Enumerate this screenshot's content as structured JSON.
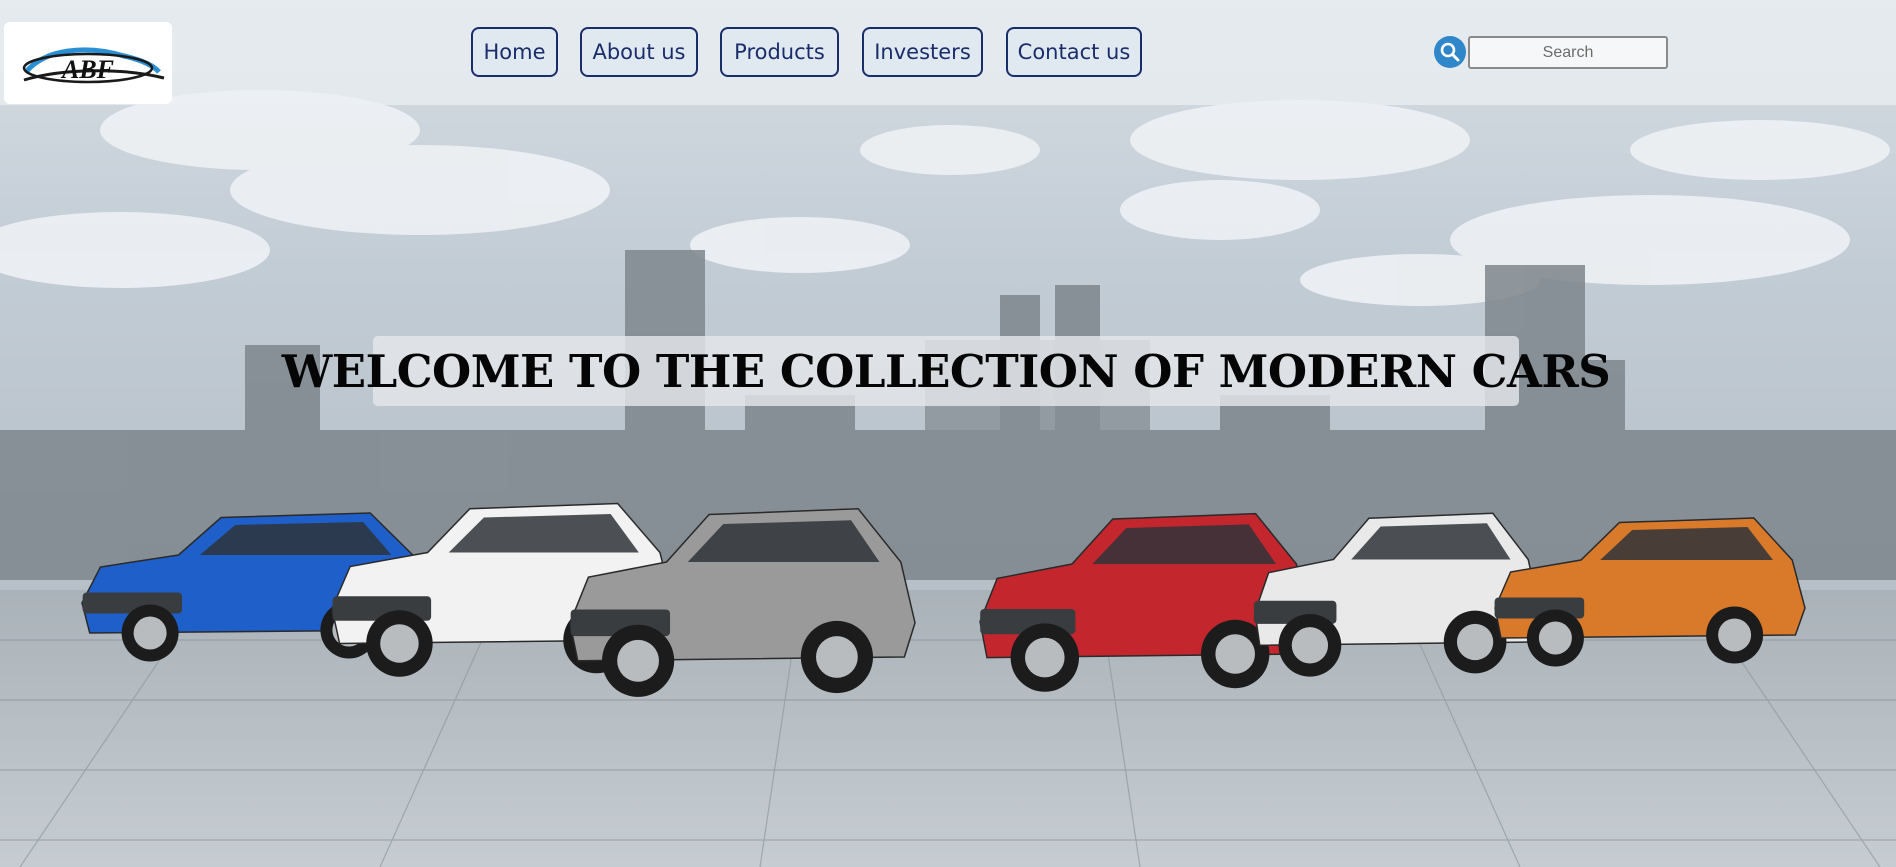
{
  "header": {
    "brand": "ABF",
    "nav": [
      {
        "label": "Home"
      },
      {
        "label": "About us"
      },
      {
        "label": "Products"
      },
      {
        "label": "Investers"
      },
      {
        "label": "Contact us"
      }
    ],
    "search": {
      "placeholder": "Search",
      "icon": "search-icon"
    }
  },
  "hero": {
    "headline": "WELCOME TO THE COLLECTION OF MODERN CARS",
    "car_colors": [
      "#1f5fc9",
      "#f2f2f2",
      "#9a9a9a",
      "#c4262d",
      "#e9e9e9",
      "#d97a2b"
    ]
  },
  "colors": {
    "nav_border": "#1a2d6b",
    "search_button": "#2f86c9"
  }
}
